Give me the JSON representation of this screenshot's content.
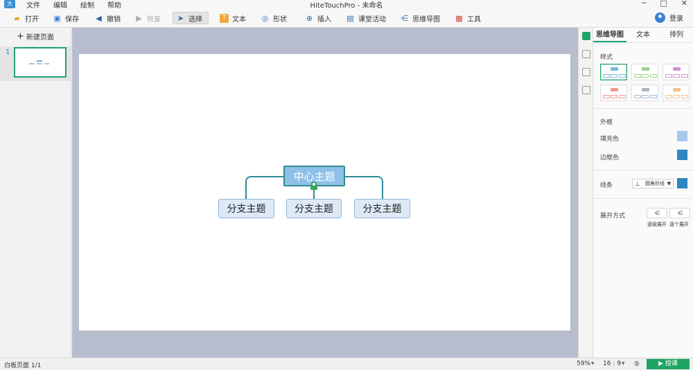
{
  "window": {
    "title": "HiteTouchPro - 未命名",
    "logo": "大"
  },
  "menu": [
    "文件",
    "编辑",
    "绘制",
    "帮助"
  ],
  "toolbar": {
    "open": "打开",
    "save": "保存",
    "undo": "撤销",
    "redo": "恢复",
    "select": "选择",
    "text": "文本",
    "shape": "形状",
    "insert": "插入",
    "activity": "课堂活动",
    "mindmap": "思维导图",
    "tools": "工具",
    "login": "登录"
  },
  "pages": {
    "new_page": "新建页面",
    "items": [
      {
        "number": "1"
      }
    ]
  },
  "mindmap": {
    "central": "中心主题",
    "branches": [
      "分支主题",
      "分支主题",
      "分支主题"
    ]
  },
  "props": {
    "tabs": [
      "思维导图",
      "文本",
      "排列"
    ],
    "active_tab": "思维导图",
    "style_label": "样式",
    "frame_label": "外框",
    "fill_label": "填充色",
    "border_label": "边框色",
    "line_label": "线条",
    "line_style": "圆角折线",
    "expand_label": "展开方式",
    "expand_level": "逐级展开",
    "expand_each": "逐个展开",
    "colors": {
      "fill": "#a6c8ec",
      "border": "#2e86c1",
      "line": "#2e86c1"
    },
    "styles": [
      {
        "color": "#7bb7e6",
        "selected": true
      },
      {
        "color": "#9fd08a",
        "selected": false
      },
      {
        "color": "#d592cf",
        "selected": false
      },
      {
        "color": "#ef9a8e",
        "selected": false
      },
      {
        "color": "#a9b6c9",
        "selected": false
      },
      {
        "color": "#f2c08a",
        "selected": false
      }
    ]
  },
  "status": {
    "page_info": "白板页面 1/1",
    "zoom": "59%",
    "ratio": "16 : 9",
    "present": "授课"
  }
}
